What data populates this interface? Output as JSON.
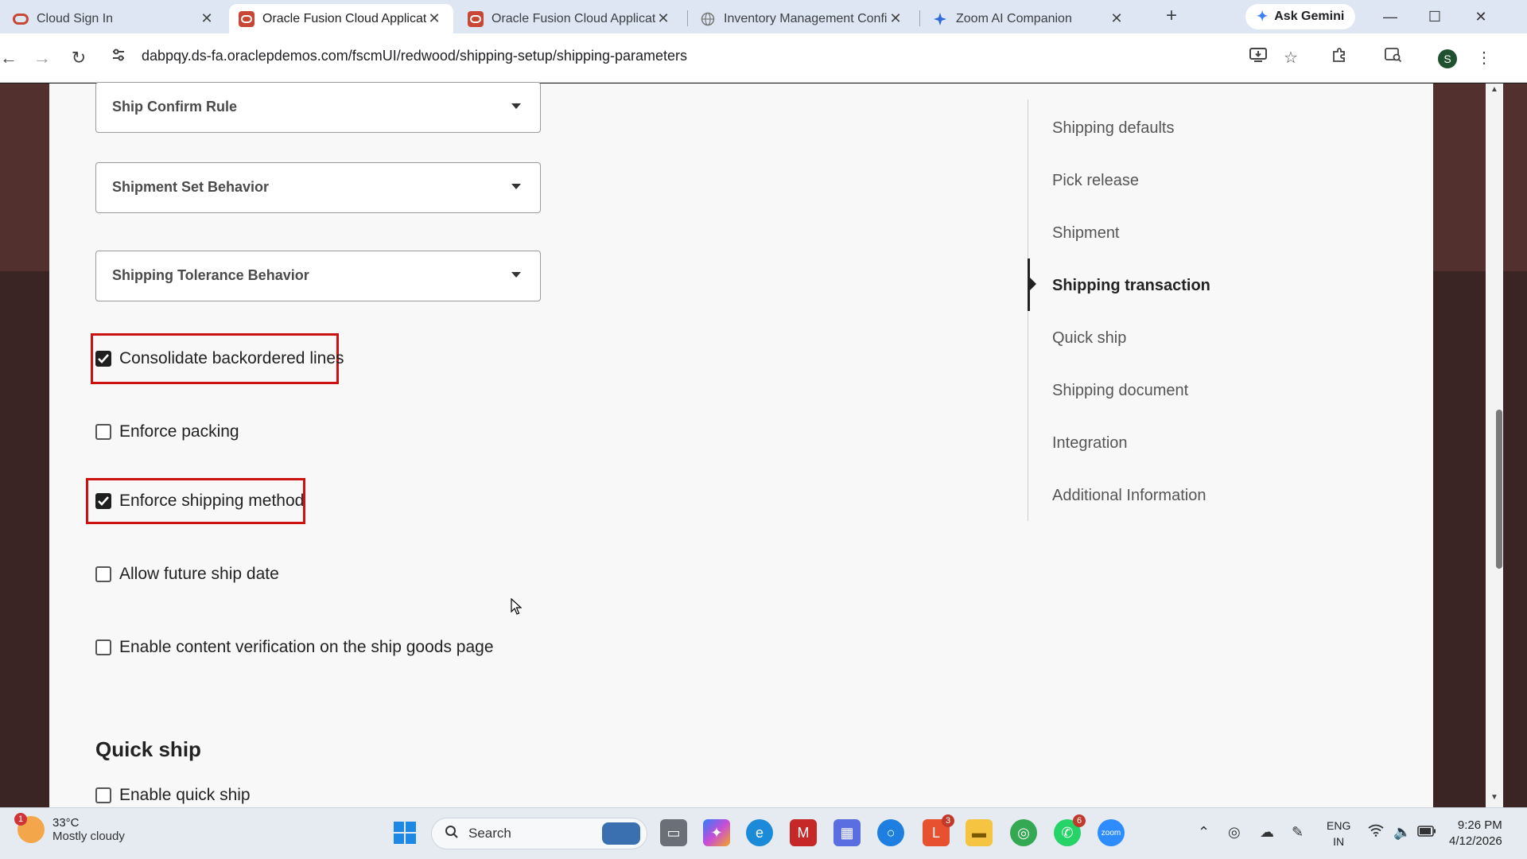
{
  "browser": {
    "tabs": [
      {
        "title": "Cloud Sign In",
        "active": false
      },
      {
        "title": "Oracle Fusion Cloud Applicatio",
        "active": true
      },
      {
        "title": "Oracle Fusion Cloud Applicatio",
        "active": false
      },
      {
        "title": "Inventory Management Config",
        "active": false
      },
      {
        "title": "Zoom AI Companion",
        "active": false
      }
    ],
    "new_tab_label": "+",
    "gemini_label": "Ask Gemini",
    "url": "dabpqy.ds-fa.oraclepdemos.com/fscmUI/redwood/shipping-setup/shipping-parameters",
    "profile_initial": "S"
  },
  "form": {
    "selects": [
      {
        "label": "Ship Confirm Rule"
      },
      {
        "label": "Shipment Set Behavior"
      },
      {
        "label": "Shipping Tolerance Behavior"
      }
    ],
    "checkboxes": [
      {
        "label": "Consolidate backordered lines",
        "checked": true
      },
      {
        "label": "Enforce packing",
        "checked": false
      },
      {
        "label": "Enforce shipping method",
        "checked": true
      },
      {
        "label": "Allow future ship date",
        "checked": false
      },
      {
        "label": "Enable content verification on the ship goods page",
        "checked": false
      }
    ],
    "quick_ship_title": "Quick ship",
    "quick_ship_checkbox": {
      "label": "Enable quick ship",
      "checked": false
    }
  },
  "side_nav": {
    "items": [
      {
        "label": "Shipping defaults",
        "current": false
      },
      {
        "label": "Pick release",
        "current": false
      },
      {
        "label": "Shipment",
        "current": false
      },
      {
        "label": "Shipping transaction",
        "current": true
      },
      {
        "label": "Quick ship",
        "current": false
      },
      {
        "label": "Shipping document",
        "current": false
      },
      {
        "label": "Integration",
        "current": false
      },
      {
        "label": "Additional Information",
        "current": false
      }
    ]
  },
  "taskbar": {
    "weather": {
      "temp": "33°C",
      "condition": "Mostly cloudy",
      "badge": "1"
    },
    "search_label": "Search",
    "badges": {
      "l_app": "3",
      "whatsapp": "6"
    },
    "lang_top": "ENG",
    "lang_bottom": "IN",
    "time": "9:26 PM",
    "date": "4/12/2026"
  },
  "colors": {
    "highlight": "#cc1111",
    "banner": "#51302e",
    "oracle_red": "#c74634"
  }
}
